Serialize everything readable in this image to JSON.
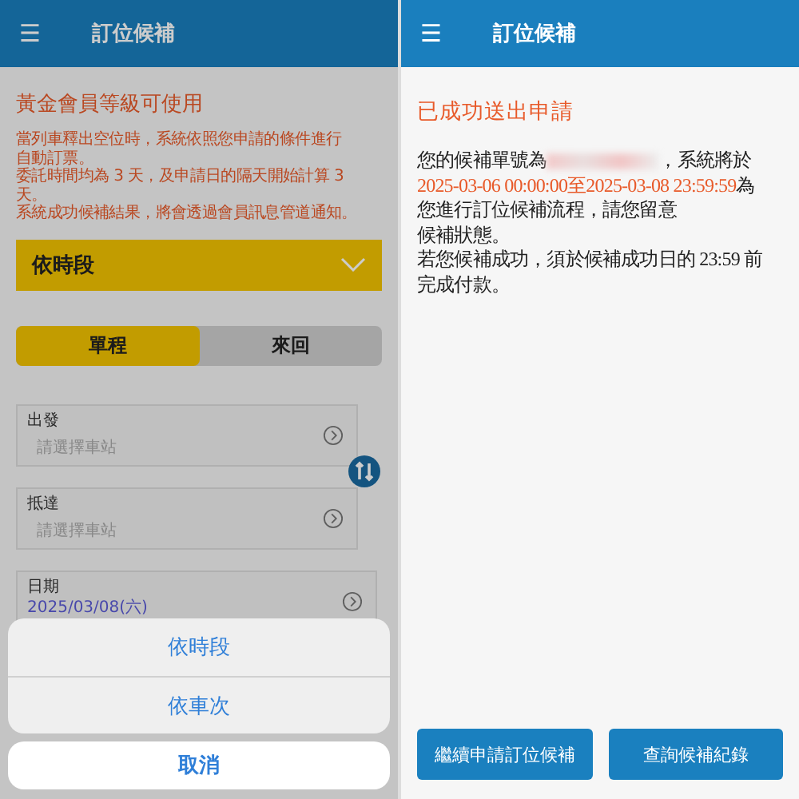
{
  "left_screen": {
    "header": {
      "menu_icon": "☰",
      "title": "訂位候補"
    },
    "notice_title": "黃金會員等級可使用",
    "notice_lines": [
      "當列車釋出空位時，系統依照您申請的條件進行",
      "自動訂票。",
      "委託時間均為 3 天，及申請日的隔天開始計算 3",
      "天。",
      "系統成功候補結果，將會透過會員訊息管道通知。"
    ],
    "mode_dropdown": {
      "value": "依時段"
    },
    "trip_toggle": [
      {
        "label": "單程",
        "selected": true
      },
      {
        "label": "來回",
        "selected": false
      }
    ],
    "fields": [
      {
        "label": "出發",
        "placeholder": "請選擇車站"
      },
      {
        "label": "抵達",
        "placeholder": "請選擇車站"
      },
      {
        "label": "日期",
        "value": "2025/03/08(六)"
      }
    ],
    "action_sheet": {
      "options": [
        "依時段",
        "依車次"
      ],
      "cancel": "取消"
    }
  },
  "right_screen": {
    "header": {
      "menu_icon": "☰",
      "title": "訂位候補"
    },
    "title": "已成功送出申請",
    "message_lines": [
      [
        {
          "text": "您的候補單號為",
          "highlight": false
        },
        {
          "kind": "redacted"
        },
        {
          "text": "，系統將於",
          "highlight": false
        }
      ],
      [
        {
          "text": "2025-03-06 00:00:00至2025-03-08 23:59:59",
          "highlight": true
        },
        {
          "text": "為",
          "highlight": false
        }
      ],
      [
        {
          "text": "您進行訂位候補流程，請您留意",
          "highlight": false
        }
      ],
      [
        {
          "text": "候補狀態。",
          "highlight": false
        }
      ],
      [
        {
          "text": "若您候補成功，須於候補成功日的 23:59 前",
          "highlight": false
        }
      ],
      [
        {
          "text": "完成付款。",
          "highlight": false
        }
      ]
    ],
    "buttons": [
      "繼續申請訂位候補",
      "查詢候補紀錄"
    ]
  }
}
